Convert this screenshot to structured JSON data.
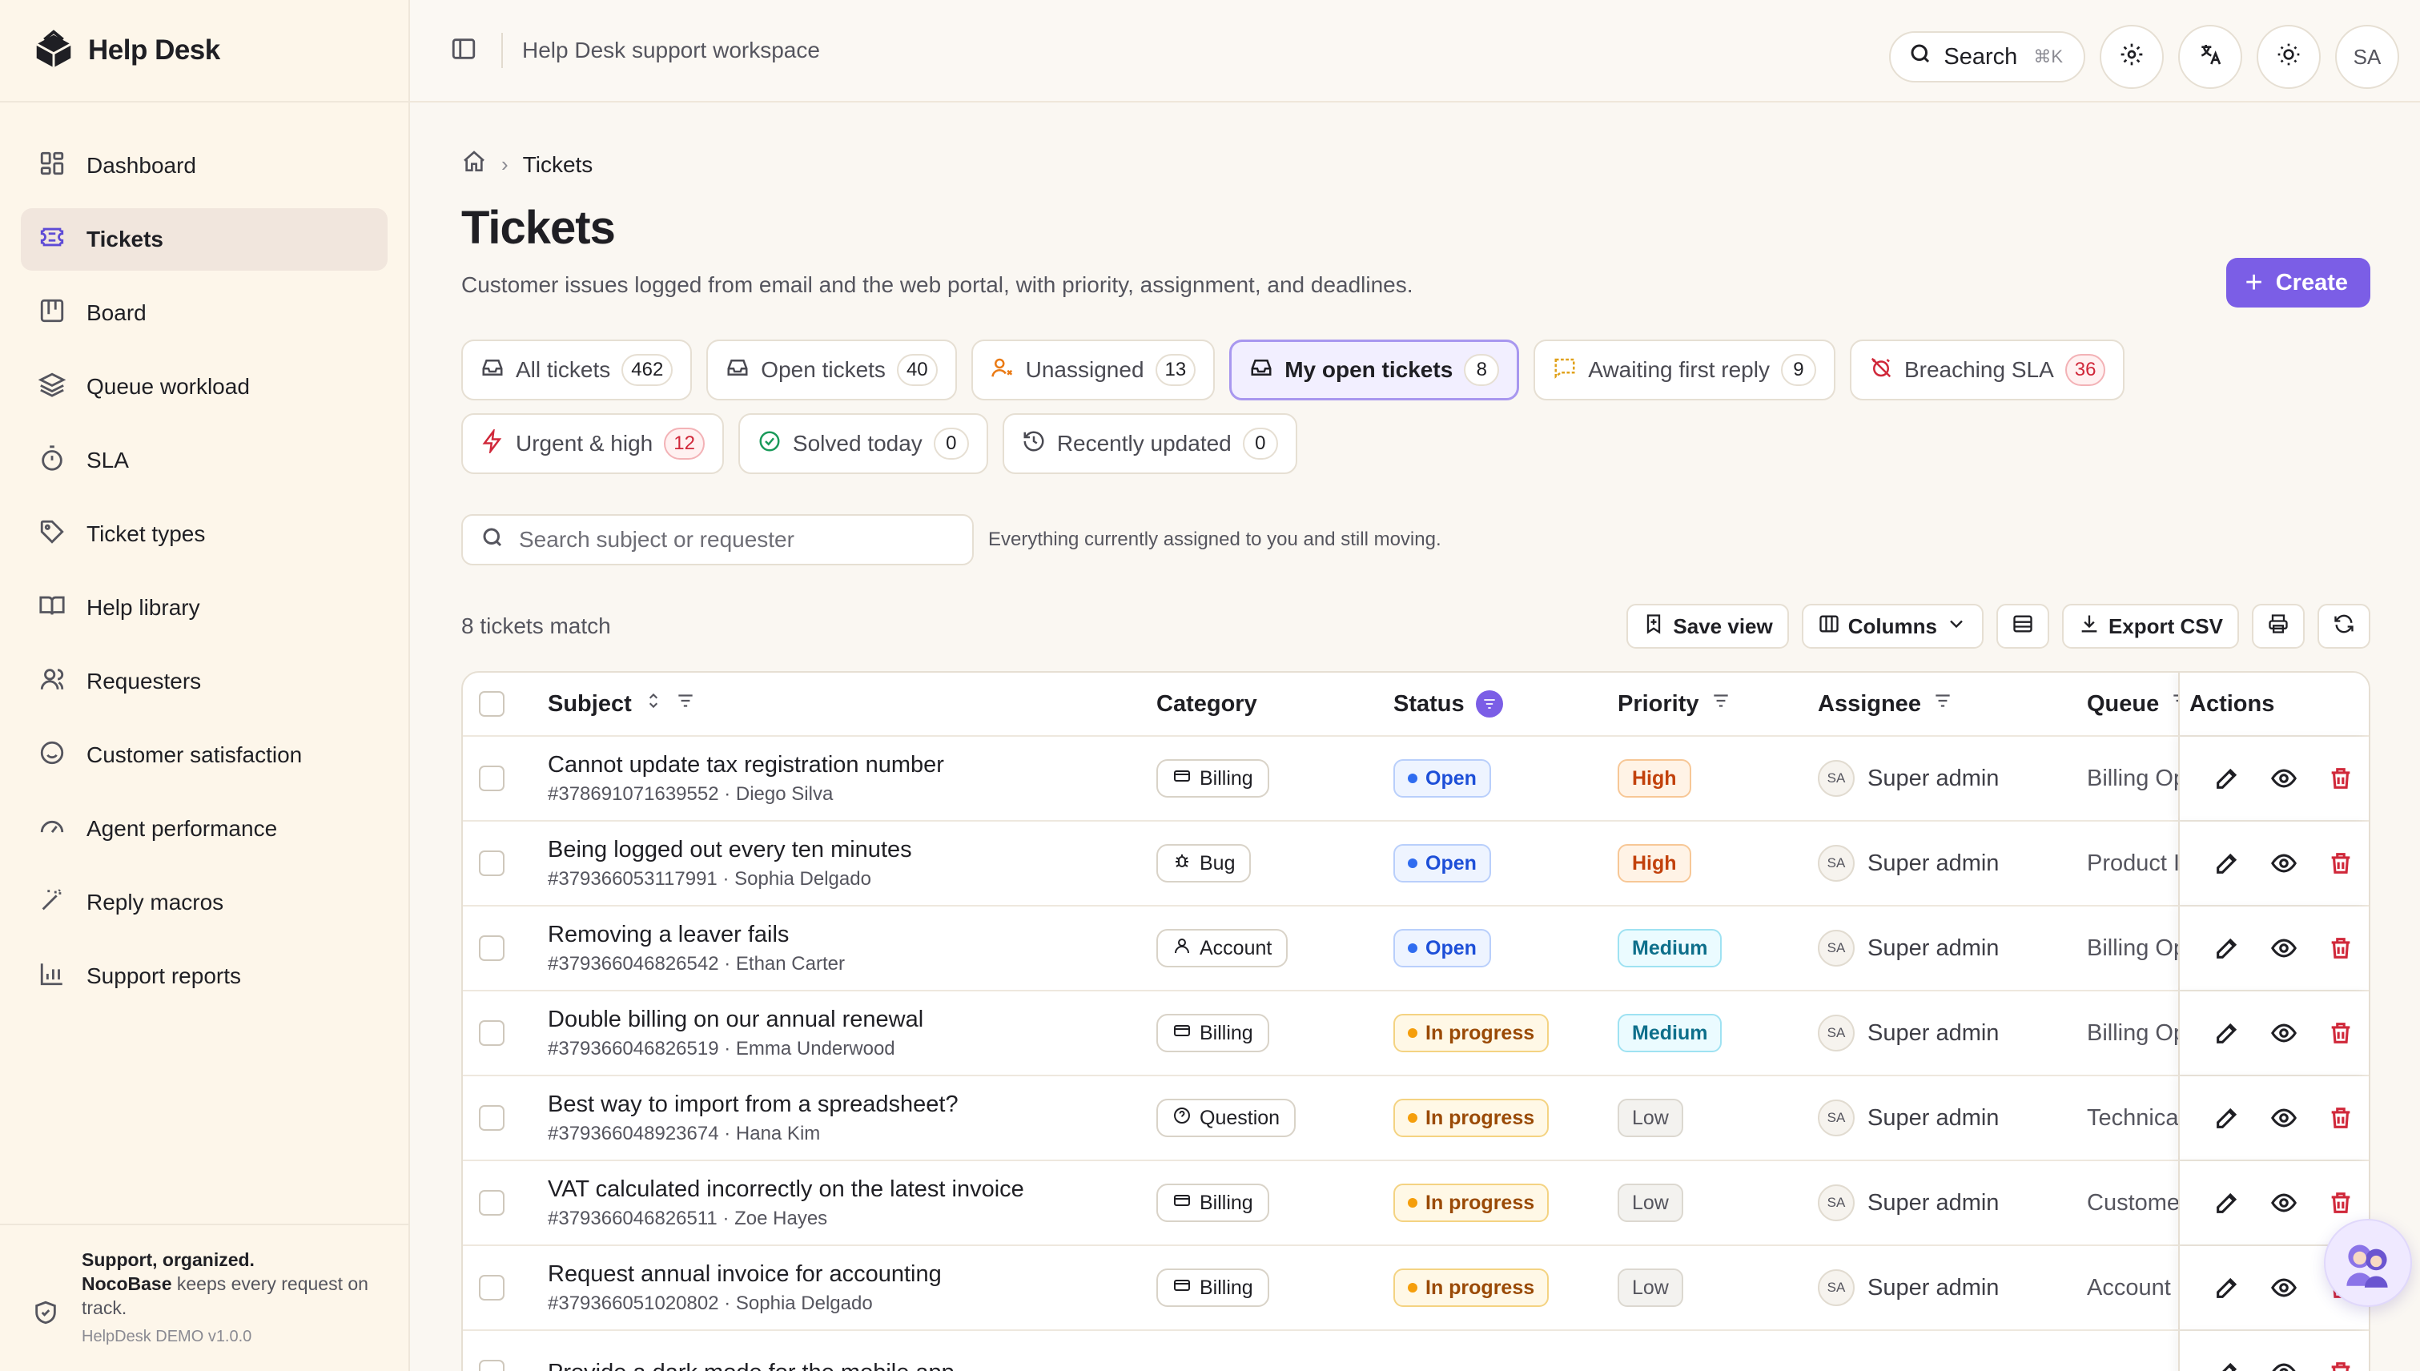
{
  "app": {
    "name": "Help Desk",
    "workspace": "Help Desk support workspace"
  },
  "topbar": {
    "search_label": "Search",
    "search_shortcut": "⌘K",
    "user_initials": "SA"
  },
  "sidebar": {
    "items": [
      {
        "label": "Dashboard",
        "icon": "dashboard-icon"
      },
      {
        "label": "Tickets",
        "icon": "ticket-icon",
        "active": true
      },
      {
        "label": "Board",
        "icon": "board-icon"
      },
      {
        "label": "Queue workload",
        "icon": "layers-icon"
      },
      {
        "label": "SLA",
        "icon": "timer-icon"
      },
      {
        "label": "Ticket types",
        "icon": "tag-icon"
      },
      {
        "label": "Help library",
        "icon": "book-icon"
      },
      {
        "label": "Requesters",
        "icon": "users-icon"
      },
      {
        "label": "Customer satisfaction",
        "icon": "smile-icon"
      },
      {
        "label": "Agent performance",
        "icon": "gauge-icon"
      },
      {
        "label": "Reply macros",
        "icon": "wand-icon"
      },
      {
        "label": "Support reports",
        "icon": "chart-icon"
      }
    ],
    "footer": {
      "headline": "Support, organized.",
      "brand": "NocoBase",
      "tagline": " keeps every request on track.",
      "version": "HelpDesk DEMO v1.0.0"
    }
  },
  "breadcrumb": {
    "current": "Tickets"
  },
  "page": {
    "title": "Tickets",
    "subtitle": "Customer issues logged from email and the web portal, with priority, assignment, and deadlines.",
    "create_label": "Create"
  },
  "views": [
    {
      "label": "All tickets",
      "count": "462"
    },
    {
      "label": "Open tickets",
      "count": "40"
    },
    {
      "label": "Unassigned",
      "count": "13"
    },
    {
      "label": "My open tickets",
      "count": "8",
      "active": true
    },
    {
      "label": "Awaiting first reply",
      "count": "9"
    },
    {
      "label": "Breaching SLA",
      "count": "36",
      "alert": true
    },
    {
      "label": "Urgent & high",
      "count": "12",
      "alert": true
    },
    {
      "label": "Solved today",
      "count": "0"
    },
    {
      "label": "Recently updated",
      "count": "0"
    }
  ],
  "search": {
    "placeholder": "Search subject or requester",
    "hint": "Everything currently assigned to you and still moving."
  },
  "toolbar": {
    "match_text": "8 tickets match",
    "save_view": "Save view",
    "columns": "Columns",
    "export": "Export CSV"
  },
  "table": {
    "columns": {
      "subject": "Subject",
      "category": "Category",
      "status": "Status",
      "priority": "Priority",
      "assignee": "Assignee",
      "queue": "Queue",
      "actions": "Actions"
    },
    "rows": [
      {
        "subject": "Cannot update tax registration number",
        "meta": "#378691071639552 · Diego Silva",
        "category": "Billing",
        "status": "Open",
        "priority": "High",
        "assignee": "Super admin",
        "assignee_initials": "SA",
        "queue": "Billing Op"
      },
      {
        "subject": "Being logged out every ten minutes",
        "meta": "#379366053117991 · Sophia Delgado",
        "category": "Bug",
        "status": "Open",
        "priority": "High",
        "assignee": "Super admin",
        "assignee_initials": "SA",
        "queue": "Product I"
      },
      {
        "subject": "Removing a leaver fails",
        "meta": "#379366046826542 · Ethan Carter",
        "category": "Account",
        "status": "Open",
        "priority": "Medium",
        "assignee": "Super admin",
        "assignee_initials": "SA",
        "queue": "Billing Op"
      },
      {
        "subject": "Double billing on our annual renewal",
        "meta": "#379366046826519 · Emma Underwood",
        "category": "Billing",
        "status": "In progress",
        "priority": "Medium",
        "assignee": "Super admin",
        "assignee_initials": "SA",
        "queue": "Billing Op"
      },
      {
        "subject": "Best way to import from a spreadsheet?",
        "meta": "#379366048923674 · Hana Kim",
        "category": "Question",
        "status": "In progress",
        "priority": "Low",
        "assignee": "Super admin",
        "assignee_initials": "SA",
        "queue": "Technica"
      },
      {
        "subject": "VAT calculated incorrectly on the latest invoice",
        "meta": "#379366046826511 · Zoe Hayes",
        "category": "Billing",
        "status": "In progress",
        "priority": "Low",
        "assignee": "Super admin",
        "assignee_initials": "SA",
        "queue": "Custome"
      },
      {
        "subject": "Request annual invoice for accounting",
        "meta": "#379366051020802 · Sophia Delgado",
        "category": "Billing",
        "status": "In progress",
        "priority": "Low",
        "assignee": "Super admin",
        "assignee_initials": "SA",
        "queue": "Account"
      },
      {
        "subject": "Provide a dark mode for the mobile app",
        "meta": "",
        "category": "",
        "status": "",
        "priority": "",
        "assignee": "",
        "assignee_initials": "",
        "queue": ""
      }
    ]
  }
}
